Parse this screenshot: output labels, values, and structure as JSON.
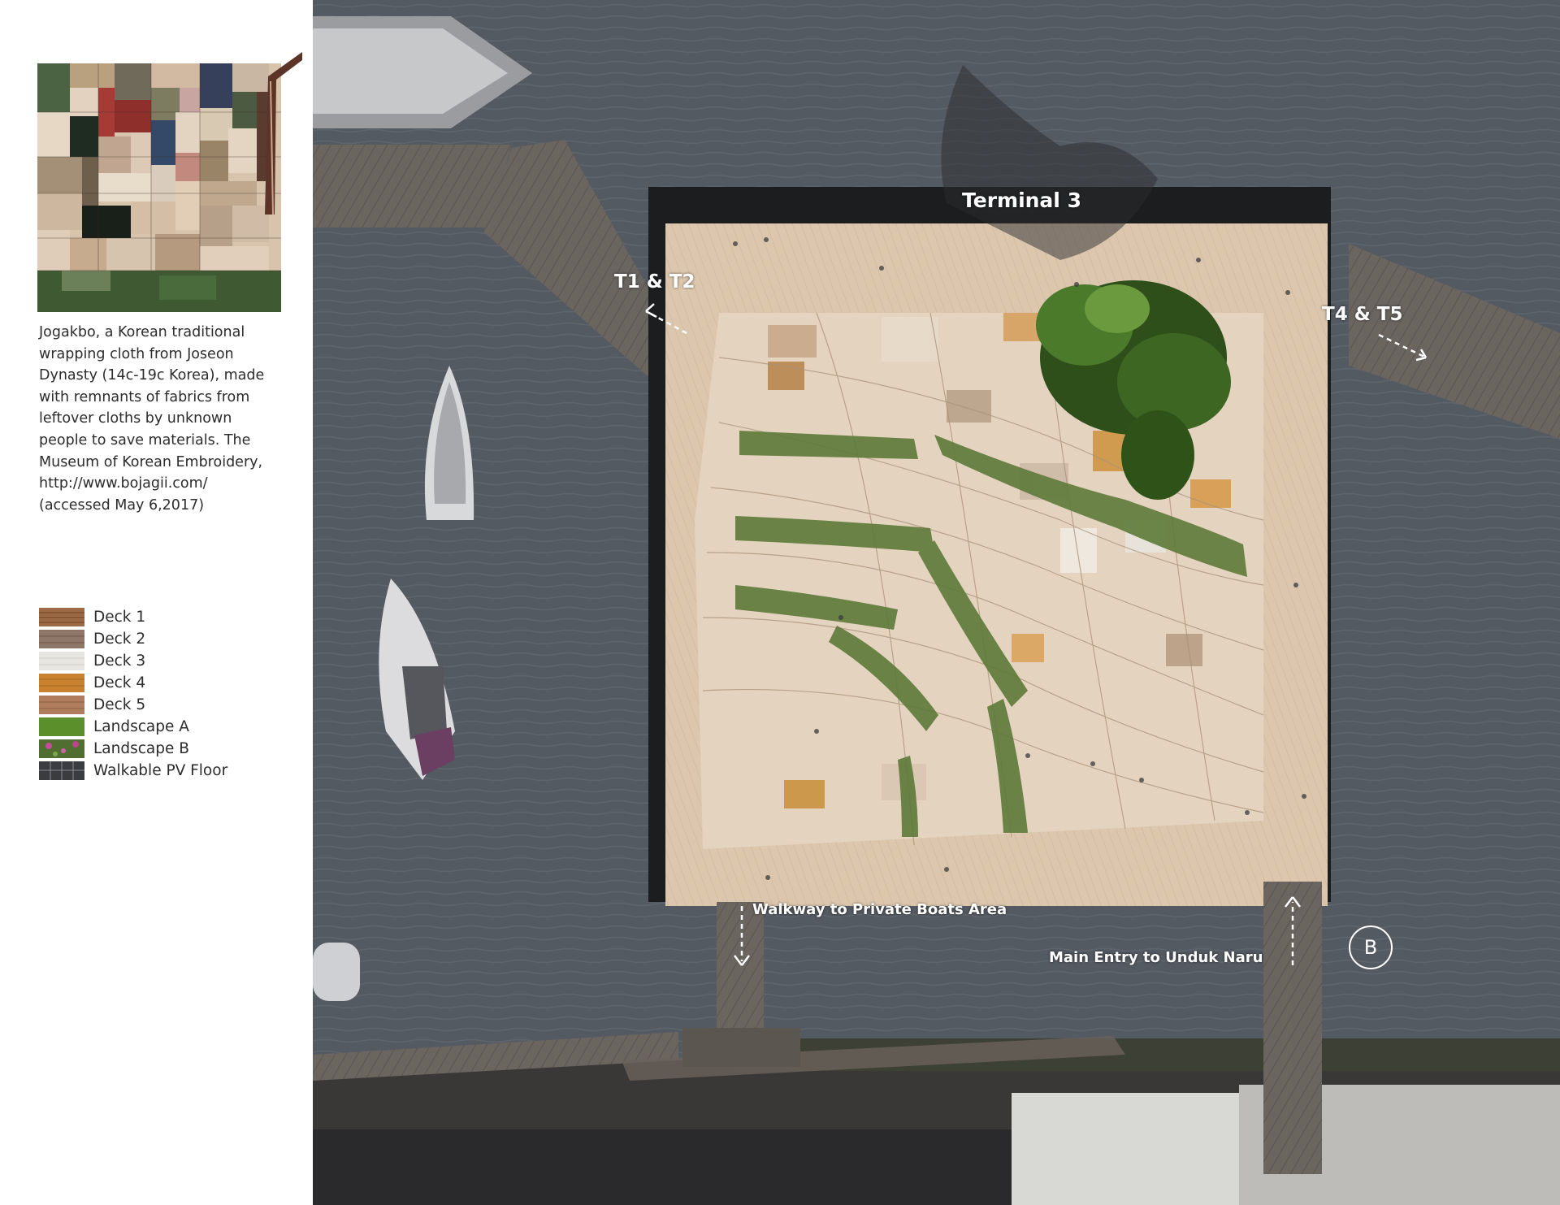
{
  "sidebar": {
    "caption": "Jogakbo, a Korean traditional wrapping cloth from Joseon Dynasty (14c-19c Korea), made with remnants of fabrics from leftover cloths by unknown people to save materials. The Museum of Korean Embroidery, http://www.bojagii.com/ (accessed May 6,2017)",
    "legend": [
      {
        "label": "Deck 1",
        "color": "#9c6b45"
      },
      {
        "label": "Deck 2",
        "color": "#8e7767"
      },
      {
        "label": "Deck 3",
        "color": "#e8e6e2"
      },
      {
        "label": "Deck 4",
        "color": "#c7812f"
      },
      {
        "label": "Deck 5",
        "color": "#b07c5e"
      },
      {
        "label": "Landscape A",
        "color": "#5a8f2c"
      },
      {
        "label": "Landscape B",
        "color": "#4f6e2f"
      },
      {
        "label": "Walkable PV Floor",
        "color": "#3a3c40"
      }
    ]
  },
  "map": {
    "terminal_label": "Terminal 3",
    "t1_t2_label": "T1 & T2",
    "t4_t5_label": "T4 & T5",
    "walkway_label": "Walkway to Private Boats Area",
    "main_entry_label": "Main Entry to Unduk Naru",
    "section_marker": "B"
  }
}
